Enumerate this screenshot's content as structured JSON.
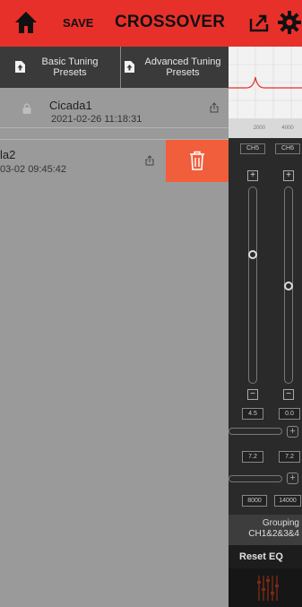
{
  "header": {
    "save_label": "SAVE",
    "title": "CROSSOVER",
    "home_icon": "home-icon",
    "export_icon": "export-icon",
    "settings_icon": "gear-icon",
    "bg_color": "#e8302a"
  },
  "drawer": {
    "tabs": [
      {
        "label": "Basic Tuning\nPresets",
        "icon": "file-upload-icon"
      },
      {
        "label": "Advanced Tuning\nPresets",
        "icon": "file-upload-icon"
      }
    ],
    "presets": [
      {
        "name": "Cicada1",
        "date": "2021-02-26 11:18:31",
        "locked": true
      },
      {
        "name": "la2",
        "date": "03-02 09:45:42",
        "locked": false
      }
    ],
    "delete_color": "#f05e3c"
  },
  "background": {
    "graph_ticks": [
      "",
      "2000",
      "4000"
    ],
    "channels": [
      "CH5",
      "CH6"
    ],
    "values_row1": [
      "4.5",
      "0.0"
    ],
    "values_row2": [
      "7.2",
      "7.2"
    ],
    "values_row3": [
      "8000",
      "14000"
    ],
    "grouping_label": "Grouping",
    "grouping_value": "CH1&2&3&4",
    "reset_label": "Reset EQ"
  }
}
